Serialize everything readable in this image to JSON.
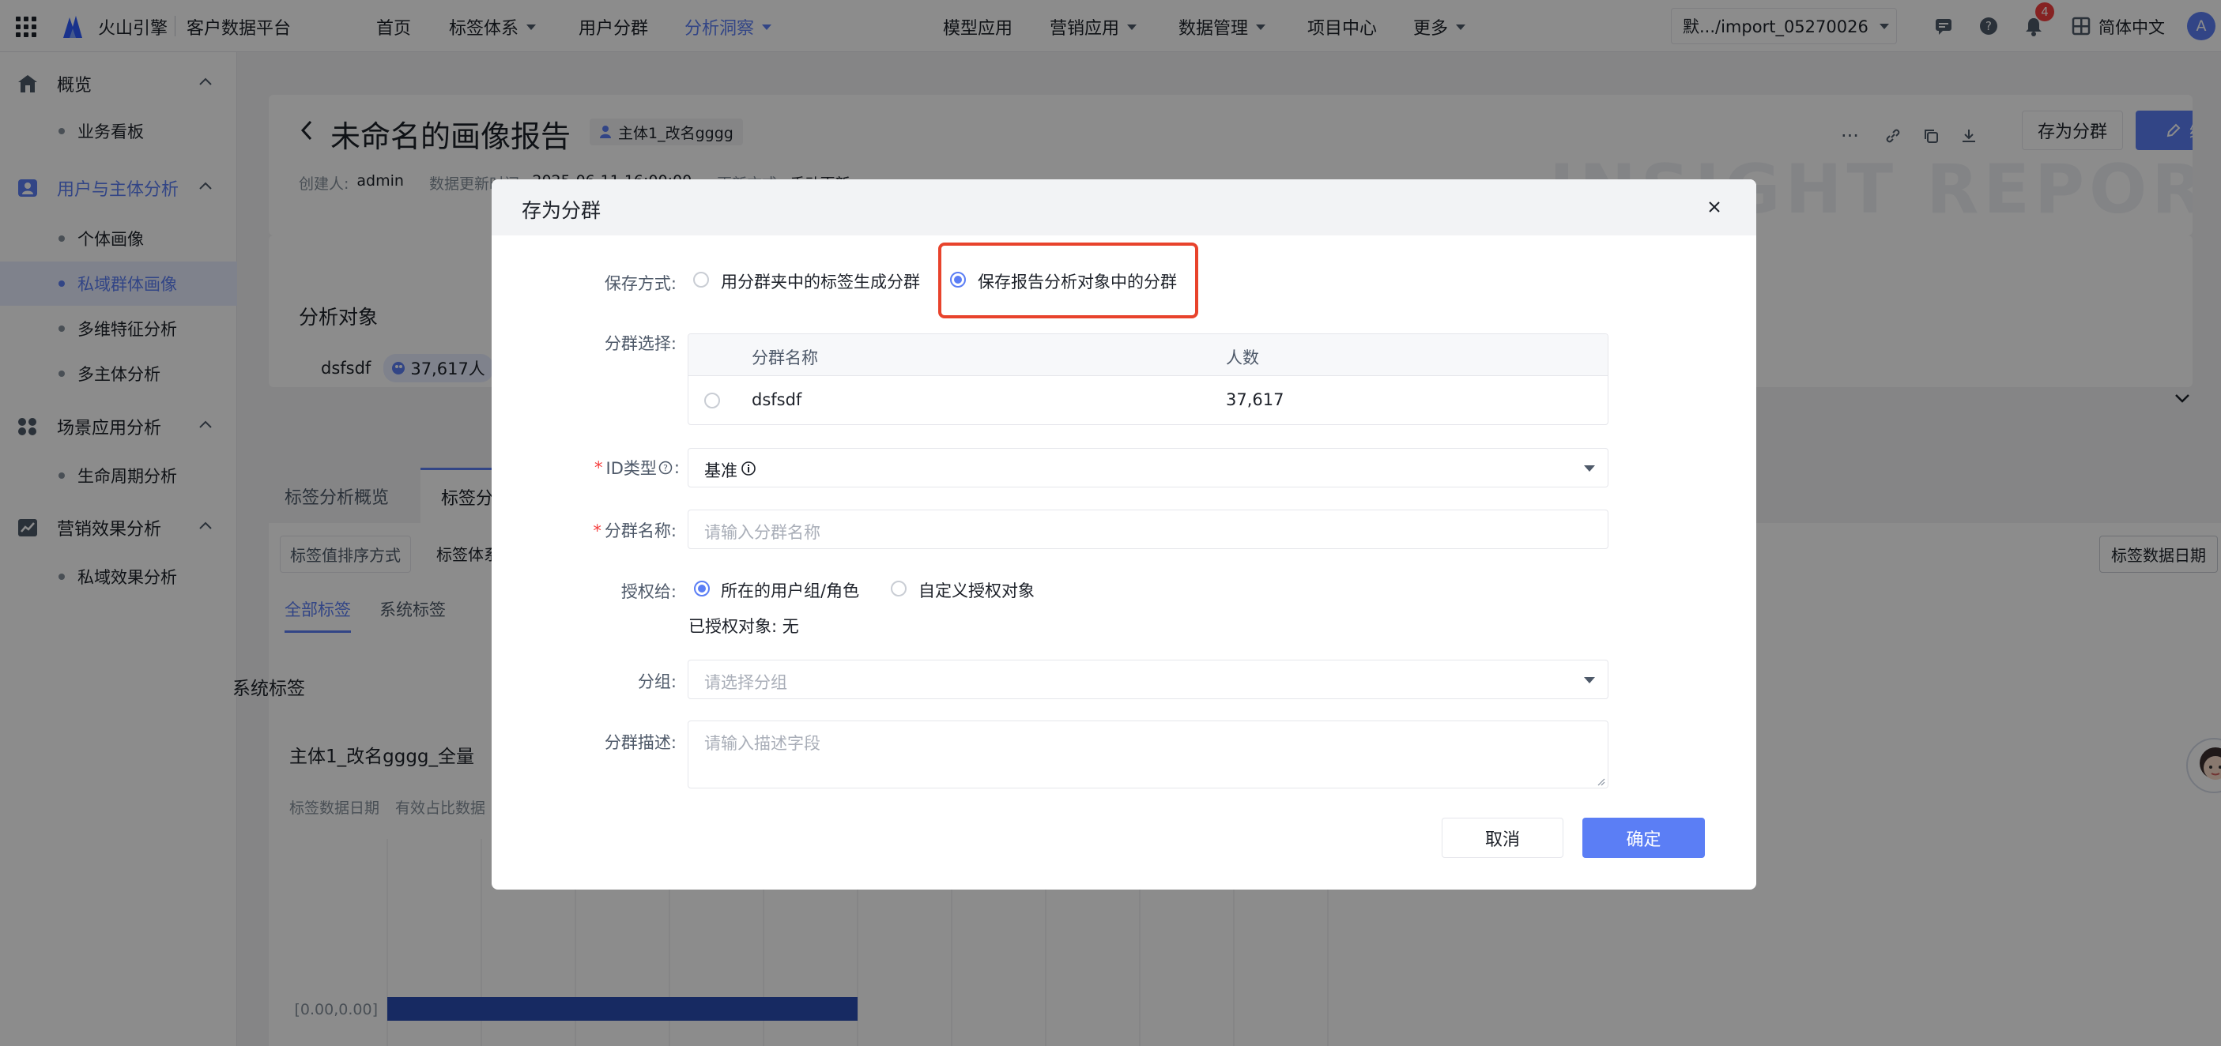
{
  "topbar": {
    "brand": "火山引擎",
    "platform": "客户数据平台",
    "nav": [
      {
        "label": "首页",
        "dropdown": false,
        "active": false
      },
      {
        "label": "标签体系",
        "dropdown": true,
        "active": false
      },
      {
        "label": "用户分群",
        "dropdown": false,
        "active": false
      },
      {
        "label": "分析洞察",
        "dropdown": true,
        "active": true
      },
      {
        "label": "模型应用",
        "dropdown": false,
        "active": false
      },
      {
        "label": "营销应用",
        "dropdown": true,
        "active": false
      },
      {
        "label": "数据管理",
        "dropdown": true,
        "active": false
      },
      {
        "label": "项目中心",
        "dropdown": false,
        "active": false
      },
      {
        "label": "更多",
        "dropdown": true,
        "active": false
      }
    ],
    "project": "默.../import_05270026",
    "notification_count": "4",
    "language": "简体中文",
    "avatar": "A"
  },
  "sidebar": {
    "groups": [
      {
        "label": "概览",
        "icon": "home-icon",
        "items": [
          "业务看板"
        ]
      },
      {
        "label": "用户与主体分析",
        "icon": "user-icon",
        "items": [
          "个体画像",
          "私域群体画像",
          "多维特征分析",
          "多主体分析"
        ]
      },
      {
        "label": "场景应用分析",
        "icon": "apps-icon",
        "items": [
          "生命周期分析"
        ]
      },
      {
        "label": "营销效果分析",
        "icon": "chart-icon",
        "items": [
          "私域效果分析"
        ]
      }
    ],
    "active_item": "私域群体画像"
  },
  "report": {
    "title": "未命名的画像报告",
    "subject_tag": "主体1_改名gggg",
    "creator_label": "创建人:",
    "creator": "admin",
    "updated_label": "数据更新时间:",
    "updated": "2025-06-11 16:00:00",
    "update_mode_label": "更新方式:",
    "update_mode": "手动更新",
    "save_group_button": "存为分群",
    "edit_button": "编辑",
    "watermark": "INSIGHT REPORT",
    "analysis_object_title": "分析对象",
    "object_name": "dsfsdf",
    "object_count": "37,617人",
    "tabs": [
      "标签分析概览",
      "标签分"
    ],
    "filters": [
      "标签值排序方式",
      "标签体系"
    ],
    "label_date_button": "标签数据日期",
    "subtabs": [
      "全部标签",
      "系统标签"
    ],
    "section_title": "系统标签",
    "subject_card_title": "主体1_改名gggg_全量",
    "card_meta": [
      "标签数据日期",
      "有效占比数据"
    ],
    "chart_data": {
      "type": "bar",
      "categories": [
        "[0.00,0.00]"
      ],
      "values": [
        1
      ]
    }
  },
  "modal": {
    "title": "存为分群",
    "save_mode_label": "保存方式:",
    "save_mode_options": [
      "用分群夹中的标签生成分群",
      "保存报告分析对象中的分群"
    ],
    "save_mode_selected": 1,
    "group_select_label": "分群选择:",
    "table_headers": [
      "分群名称",
      "人数"
    ],
    "table_rows": [
      {
        "name": "dsfsdf",
        "count": "37,617"
      }
    ],
    "id_type_label": "ID类型",
    "id_type_value": "基准",
    "group_name_label": "分群名称:",
    "group_name_placeholder": "请输入分群名称",
    "auth_label": "授权给:",
    "auth_options": [
      "所在的用户组/角色",
      "自定义授权对象"
    ],
    "auth_selected": 0,
    "authorized_text": "已授权对象: 无",
    "folder_label": "分组:",
    "folder_placeholder": "请选择分组",
    "desc_label": "分群描述:",
    "desc_placeholder": "请输入描述字段",
    "cancel": "取消",
    "confirm": "确定",
    "colon": ":"
  },
  "colors": {
    "primary": "#5b7ef5",
    "highlight": "#e8432c",
    "badge": "#f53f3f",
    "bar": "#2b4db3"
  }
}
